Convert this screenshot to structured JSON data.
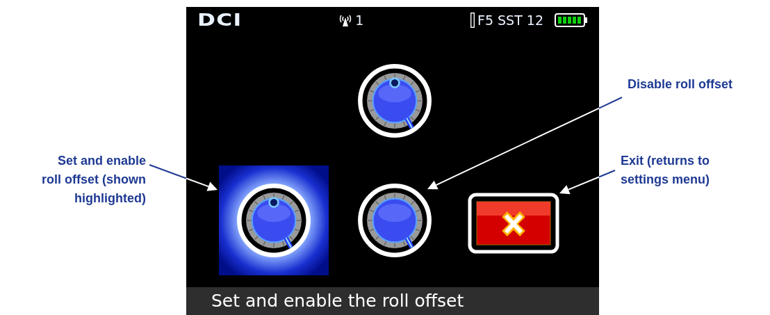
{
  "screen": {
    "status_bar": {
      "logo": "DCI",
      "channel": "1",
      "readout": "F5 SST 12"
    },
    "options": [
      {
        "kind": "knob-marked",
        "selected": false
      },
      {
        "kind": "knob-marked",
        "selected": true
      },
      {
        "kind": "knob",
        "selected": false
      },
      {
        "kind": "exit",
        "selected": false
      }
    ],
    "footer": "Set and enable the roll offset"
  },
  "callouts": [
    {
      "kind": "left",
      "lines": [
        "Set and enable",
        "roll offset (shown",
        "highlighted)"
      ]
    },
    {
      "kind": "right",
      "lines": [
        "Disable roll offset"
      ]
    },
    {
      "kind": "right",
      "lines": [
        "Exit (returns to",
        "settings menu)"
      ]
    }
  ]
}
